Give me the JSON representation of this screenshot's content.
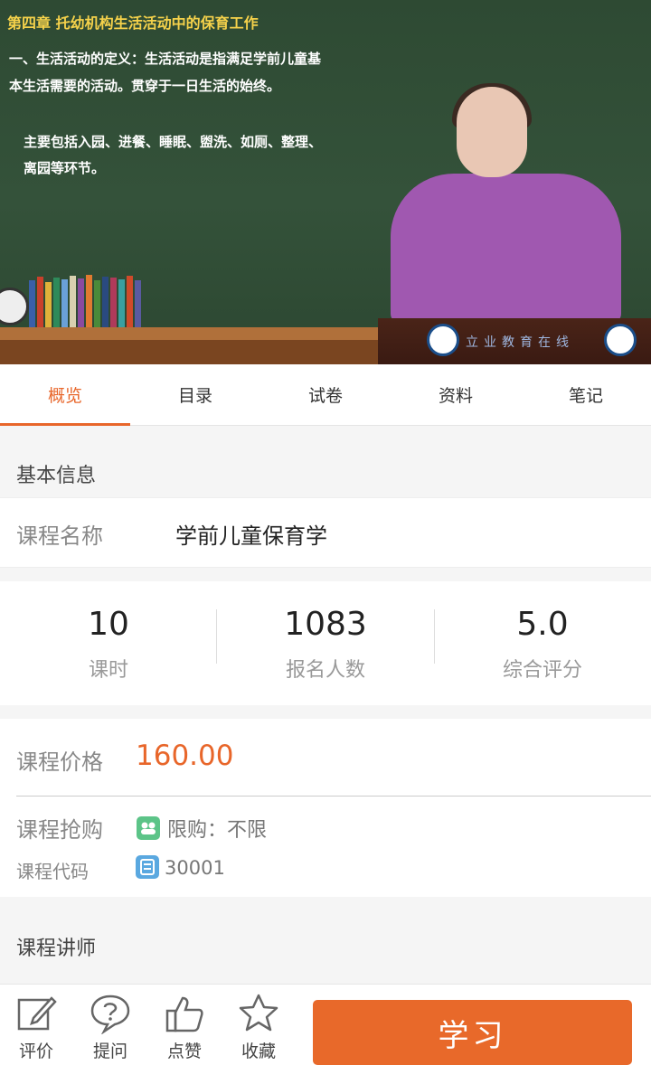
{
  "video": {
    "chapter_title": "第四章 托幼机构生活活动中的保育工作",
    "board_lines": [
      "一、生活活动的定义：生活活动是指满足学前儿童基",
      "本生活需要的活动。贯穿于一日生活的始终。",
      "主要包括入园、进餐、睡眠、盥洗、如厕、整理、",
      "离园等环节。"
    ],
    "podium_text": "立业教育在线"
  },
  "tabs": [
    {
      "label": "概览",
      "active": true
    },
    {
      "label": "目录",
      "active": false
    },
    {
      "label": "试卷",
      "active": false
    },
    {
      "label": "资料",
      "active": false
    },
    {
      "label": "笔记",
      "active": false
    }
  ],
  "basic_info": {
    "title": "基本信息",
    "course_name_label": "课程名称",
    "course_name": "学前儿童保育学"
  },
  "stats": [
    {
      "value": "10",
      "label": "课时"
    },
    {
      "value": "1083",
      "label": "报名人数"
    },
    {
      "value": "5.0",
      "label": "综合评分"
    }
  ],
  "pricing": {
    "price_label": "课程价格",
    "price": "160.00",
    "rush_label": "课程抢购",
    "rush_value": "限购：不限",
    "code_label": "课程代码",
    "code_value": "30001"
  },
  "teacher_section": {
    "title": "课程讲师"
  },
  "bottom_bar": {
    "items": [
      {
        "label": "评价",
        "icon": "edit-icon"
      },
      {
        "label": "提问",
        "icon": "question-icon"
      },
      {
        "label": "点赞",
        "icon": "thumbs-up-icon"
      },
      {
        "label": "收藏",
        "icon": "star-icon"
      }
    ],
    "learn_button": "学习"
  },
  "colors": {
    "accent": "#e8662a",
    "rush_icon": "#5cc488",
    "code_icon": "#5aa8e0"
  }
}
